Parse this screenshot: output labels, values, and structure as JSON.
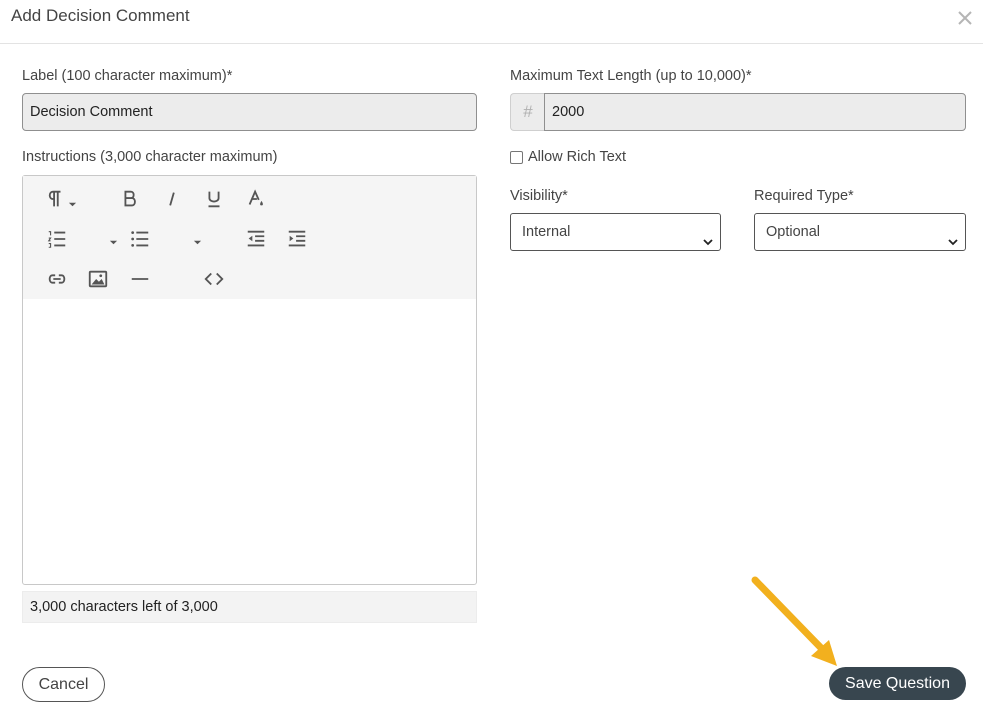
{
  "modal": {
    "title": "Add Decision Comment"
  },
  "label_field": {
    "label": "Label (100 character maximum)*",
    "value": "Decision Comment"
  },
  "max_length_field": {
    "label": "Maximum Text Length (up to 10,000)*",
    "prefix": "#",
    "value": "2000"
  },
  "instructions_field": {
    "label": "Instructions (3,000 character maximum)",
    "char_count": "3,000 characters left of 3,000"
  },
  "rich_text": {
    "label": "Allow Rich Text",
    "checked": false
  },
  "visibility": {
    "label": "Visibility*",
    "selected": "Internal"
  },
  "required_type": {
    "label": "Required Type*",
    "selected": "Optional"
  },
  "toolbar_icons": [
    "paragraph-icon",
    "bold-icon",
    "italic-icon",
    "underline-icon",
    "text-color-icon",
    "ordered-list-icon",
    "unordered-list-icon",
    "outdent-icon",
    "indent-icon",
    "link-icon",
    "image-icon",
    "horizontal-rule-icon",
    "code-view-icon"
  ],
  "buttons": {
    "cancel": "Cancel",
    "save": "Save Question"
  },
  "colors": {
    "primary_button": "#38464f",
    "annotation_arrow": "#f2b01e"
  }
}
